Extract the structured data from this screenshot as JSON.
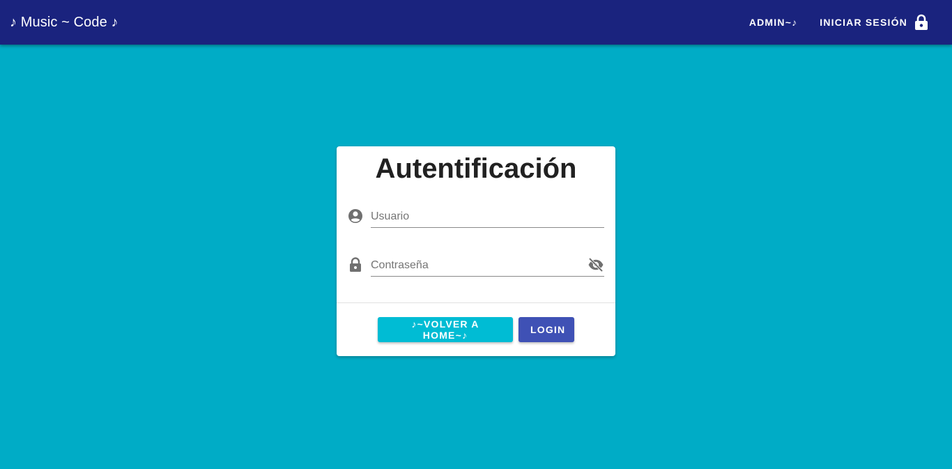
{
  "topbar": {
    "brand": "♪ Music ~ Code ♪",
    "nav": {
      "admin_label": "ADMIN~♪",
      "login_label": "INICIAR SESIÓN"
    }
  },
  "card": {
    "title": "Autentificación",
    "username": {
      "placeholder": "Usuario",
      "value": ""
    },
    "password": {
      "placeholder": "Contraseña",
      "value": ""
    },
    "actions": {
      "home_label": "♪~VOLVER A HOME~♪",
      "login_label": "LOGIN"
    }
  },
  "colors": {
    "background": "#00acc6",
    "toolbar": "#1a237e",
    "home_button": "#00bcd4",
    "login_button": "#3f51b5"
  },
  "icons": [
    "lock-icon",
    "account-circle-icon",
    "visibility-off-icon"
  ]
}
